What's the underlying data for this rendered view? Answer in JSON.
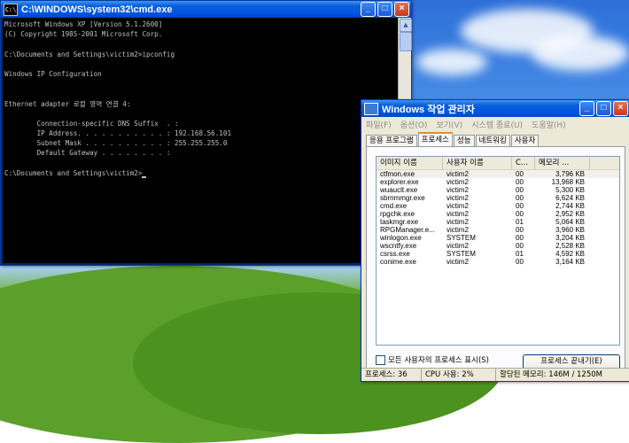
{
  "cmd": {
    "title": "C:\\WINDOWS\\system32\\cmd.exe",
    "icon_text": "C:\\",
    "lines": [
      "Microsoft Windows XP [Version 5.1.2600]",
      "(C) Copyright 1985-2001 Microsoft Corp.",
      "",
      "C:\\Documents and Settings\\victim2>ipconfig",
      "",
      "Windows IP Configuration",
      "",
      "",
      "Ethernet adapter 로컬 영역 연결 4:",
      "",
      "        Connection-specific DNS Suffix  . :",
      "        IP Address. . . . . . . . . . . : 192.168.56.101",
      "        Subnet Mask . . . . . . . . . . : 255.255.255.0",
      "        Default Gateway . . . . . . . . :",
      "",
      "C:\\Documents and Settings\\victim2>"
    ]
  },
  "taskmgr": {
    "title": "Windows 작업 관리자",
    "menu": [
      "파일(F)",
      "옵션(O)",
      "보기(V)",
      "시스템 종료(U)",
      "도움말(H)"
    ],
    "tabs": [
      "응용 프로그램",
      "프로세스",
      "성능",
      "네트워킹",
      "사용자"
    ],
    "active_tab": "프로세스",
    "columns": [
      "이미지 이름",
      "사용자 이름",
      "C...",
      "메모리 ..."
    ],
    "processes": [
      {
        "image": "ctfmon.exe",
        "user": "victim2",
        "cpu": "00",
        "mem": "3,796 KB"
      },
      {
        "image": "explorer.exe",
        "user": "victim2",
        "cpu": "00",
        "mem": "13,968 KB"
      },
      {
        "image": "wuauclt.exe",
        "user": "victim2",
        "cpu": "00",
        "mem": "5,300 KB"
      },
      {
        "image": "sbrnmmgr.exe",
        "user": "victim2",
        "cpu": "00",
        "mem": "6,624 KB"
      },
      {
        "image": "cmd.exe",
        "user": "victim2",
        "cpu": "00",
        "mem": "2,744 KB"
      },
      {
        "image": "rpgchk.exe",
        "user": "victim2",
        "cpu": "00",
        "mem": "2,952 KB"
      },
      {
        "image": "taskmgr.exe",
        "user": "victim2",
        "cpu": "01",
        "mem": "5,064 KB"
      },
      {
        "image": "RPGManager.e...",
        "user": "victim2",
        "cpu": "00",
        "mem": "3,960 KB"
      },
      {
        "image": "winlogon.exe",
        "user": "SYSTEM",
        "cpu": "00",
        "mem": "3,204 KB"
      },
      {
        "image": "wscntfy.exe",
        "user": "victim2",
        "cpu": "00",
        "mem": "2,528 KB"
      },
      {
        "image": "csrss.exe",
        "user": "SYSTEM",
        "cpu": "01",
        "mem": "4,592 KB"
      },
      {
        "image": "conime.exe",
        "user": "victim2",
        "cpu": "00",
        "mem": "3,164 KB"
      }
    ],
    "show_all_label": "모든 사용자의 프로세스 표시(S)",
    "end_process_label": "프로세스 끝내기(E)",
    "status": {
      "processes": "프로세스: 36",
      "cpu": "CPU 사용: 2%",
      "memory": "할당된 메모리: 146M / 1250M"
    }
  }
}
